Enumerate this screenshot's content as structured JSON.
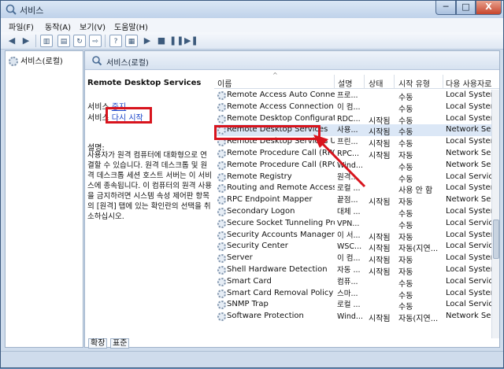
{
  "window": {
    "title": "서비스",
    "min_label": "─",
    "max_label": "□",
    "close_label": "X"
  },
  "menu": [
    "파일(F)",
    "동작(A)",
    "보기(V)",
    "도움말(H)"
  ],
  "tree": {
    "root_label": "서비스(로컬)"
  },
  "main": {
    "header": "서비스(로컬)",
    "detail": {
      "service_title": "Remote Desktop Services",
      "stop_prefix": "서비스 ",
      "stop_link": "중지",
      "restart_prefix": "서비스 ",
      "restart_link": "다시 시작",
      "desc_label": "설명:",
      "desc_text": "사용자가 원격 컴퓨터에 대화형으로 연결할 수 있습니다. 원격 데스크톱 및 원격 데스크톱 세션 호스트 서버는 이 서비스에 종속됩니다. 이 컴퓨터의 원격 사용을 금지하려면 시스템 속성 제어판 항목의 [원격] 탭에 있는 확인란의 선택을 취소하십시오."
    },
    "columns": [
      "이름",
      "설명",
      "상태",
      "시작 유형",
      "다용 사용자로"
    ],
    "rows": [
      {
        "name": "Remote Access Auto Connect...",
        "desc": "프로...",
        "state": "",
        "start": "수동",
        "logon": "Local System"
      },
      {
        "name": "Remote Access Connection ...",
        "desc": "이 컴...",
        "state": "",
        "start": "수동",
        "logon": "Local System"
      },
      {
        "name": "Remote Desktop Configuration",
        "desc": "RDC...",
        "state": "시작됨",
        "start": "수동",
        "logon": "Local System"
      },
      {
        "name": "Remote Desktop Services",
        "desc": "사용...",
        "state": "시작됨",
        "start": "수동",
        "logon": "Network Serv"
      },
      {
        "name": "Remote Desktop Services Use...",
        "desc": "프린...",
        "state": "시작됨",
        "start": "수동",
        "logon": "Local System"
      },
      {
        "name": "Remote Procedure Call (RPC)",
        "desc": "RPC...",
        "state": "시작됨",
        "start": "자동",
        "logon": "Network Serv"
      },
      {
        "name": "Remote Procedure Call (RPC)...",
        "desc": "Wind...",
        "state": "",
        "start": "수동",
        "logon": "Network Serv"
      },
      {
        "name": "Remote Registry",
        "desc": "원격...",
        "state": "",
        "start": "수동",
        "logon": "Local Service"
      },
      {
        "name": "Routing and Remote Access",
        "desc": "로컬 ...",
        "state": "",
        "start": "사용 안 함",
        "logon": "Local System"
      },
      {
        "name": "RPC Endpoint Mapper",
        "desc": "끝점...",
        "state": "시작됨",
        "start": "자동",
        "logon": "Network Serv"
      },
      {
        "name": "Secondary Logon",
        "desc": "대체 ...",
        "state": "",
        "start": "수동",
        "logon": "Local System"
      },
      {
        "name": "Secure Socket Tunneling Prot...",
        "desc": "VPN...",
        "state": "",
        "start": "수동",
        "logon": "Local Service"
      },
      {
        "name": "Security Accounts Manager",
        "desc": "이 서...",
        "state": "시작됨",
        "start": "자동",
        "logon": "Local System"
      },
      {
        "name": "Security Center",
        "desc": "WSC...",
        "state": "시작됨",
        "start": "자동(지연...",
        "logon": "Local Service"
      },
      {
        "name": "Server",
        "desc": "이 컴...",
        "state": "시작됨",
        "start": "자동",
        "logon": "Local System"
      },
      {
        "name": "Shell Hardware Detection",
        "desc": "자동 ...",
        "state": "시작됨",
        "start": "자동",
        "logon": "Local System"
      },
      {
        "name": "Smart Card",
        "desc": "컴퓨...",
        "state": "",
        "start": "수동",
        "logon": "Local Service"
      },
      {
        "name": "Smart Card Removal Policy",
        "desc": "스마...",
        "state": "",
        "start": "수동",
        "logon": "Local System"
      },
      {
        "name": "SNMP Trap",
        "desc": "로컬 ...",
        "state": "",
        "start": "수동",
        "logon": "Local Service"
      },
      {
        "name": "Software Protection",
        "desc": "Wind...",
        "state": "시작됨",
        "start": "자동(지연...",
        "logon": "Network Serv"
      }
    ],
    "tabs": [
      "확장",
      "표준"
    ]
  }
}
